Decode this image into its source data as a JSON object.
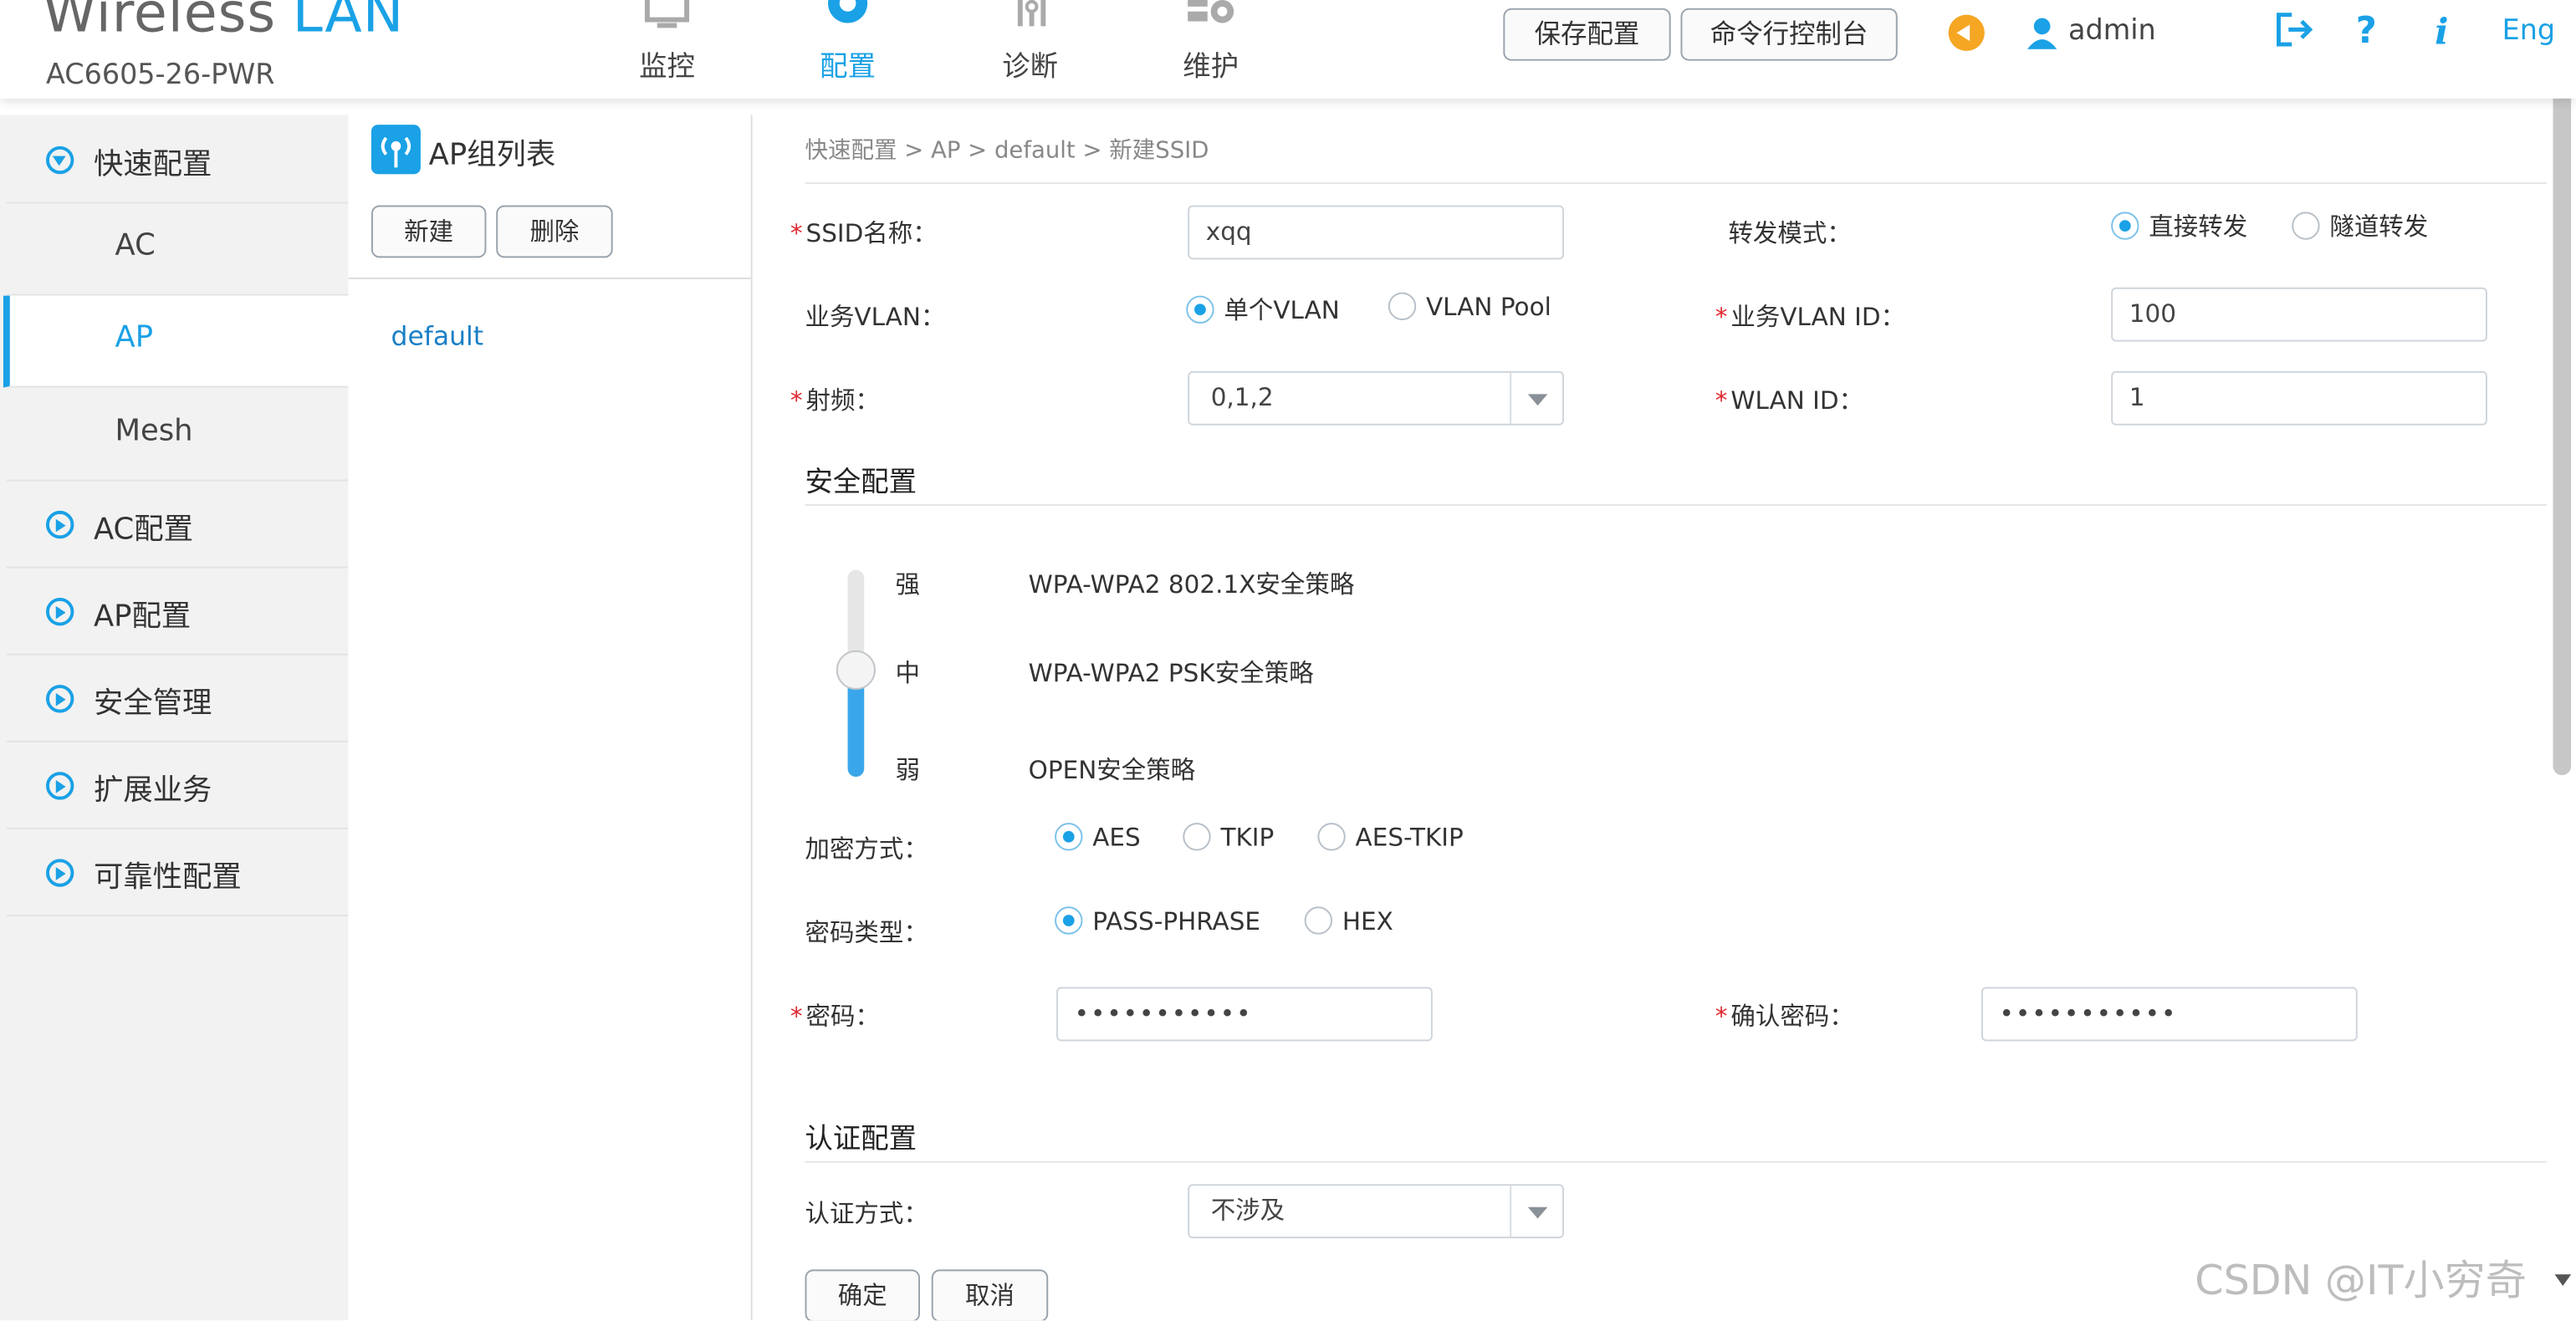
{
  "header": {
    "logo_word": "Wireless",
    "logo_lan": "LAN",
    "model": "AC6605-26-PWR",
    "tabs": [
      {
        "label": "监控",
        "icon": "monitor-icon"
      },
      {
        "label": "配置",
        "icon": "gear-icon"
      },
      {
        "label": "诊断",
        "icon": "diagnose-icon"
      },
      {
        "label": "维护",
        "icon": "maintain-icon"
      }
    ],
    "save_config": "保存配置",
    "cli_console": "命令行控制台",
    "username": "admin",
    "language": "Eng"
  },
  "sidebar": {
    "quick_config": "快速配置",
    "sub_items": [
      "AC",
      "AP",
      "Mesh"
    ],
    "items": [
      "AC配置",
      "AP配置",
      "安全管理",
      "扩展业务",
      "可靠性配置"
    ]
  },
  "group_panel": {
    "title": "AP组列表",
    "new_button": "新建",
    "delete_button": "删除",
    "groups": [
      "default"
    ]
  },
  "form": {
    "breadcrumb": "快速配置 > AP > default > 新建SSID",
    "ssid_label": "SSID名称：",
    "ssid_value": "xqq",
    "forward_label": "转发模式：",
    "forward_options": [
      "直接转发",
      "隧道转发"
    ],
    "forward_selected": "直接转发",
    "vlan_label": "业务VLAN：",
    "vlan_options": [
      "单个VLAN",
      "VLAN Pool"
    ],
    "vlan_id_label": "业务VLAN ID：",
    "vlan_id_value": "100",
    "radio_label": "射频：",
    "radio_value": "0,1,2",
    "wlan_id_label": "WLAN ID：",
    "wlan_id_value": "1",
    "security_title": "安全配置",
    "levels": [
      "强",
      "中",
      "弱"
    ],
    "policies": [
      "WPA-WPA2 802.1X安全策略",
      "WPA-WPA2 PSK安全策略",
      "OPEN安全策略"
    ],
    "security_level": "中",
    "encrypt_label": "加密方式：",
    "encrypt_options": [
      "AES",
      "TKIP",
      "AES-TKIP"
    ],
    "pwd_type_label": "密码类型：",
    "pwd_type_options": [
      "PASS-PHRASE",
      "HEX"
    ],
    "password_label": "密码：",
    "password_mask": "•••••••••••",
    "confirm_label": "确认密码：",
    "confirm_mask": "•••••••••••",
    "auth_title": "认证配置",
    "auth_label": "认证方式：",
    "auth_value": "不涉及",
    "ok_button": "确定",
    "cancel_button": "取消"
  },
  "watermark": "CSDN @IT小穷奇",
  "colors": {
    "accent": "#1aa1e6",
    "required": "#e0282f",
    "sidebar_bg": "#f2f2f2"
  }
}
